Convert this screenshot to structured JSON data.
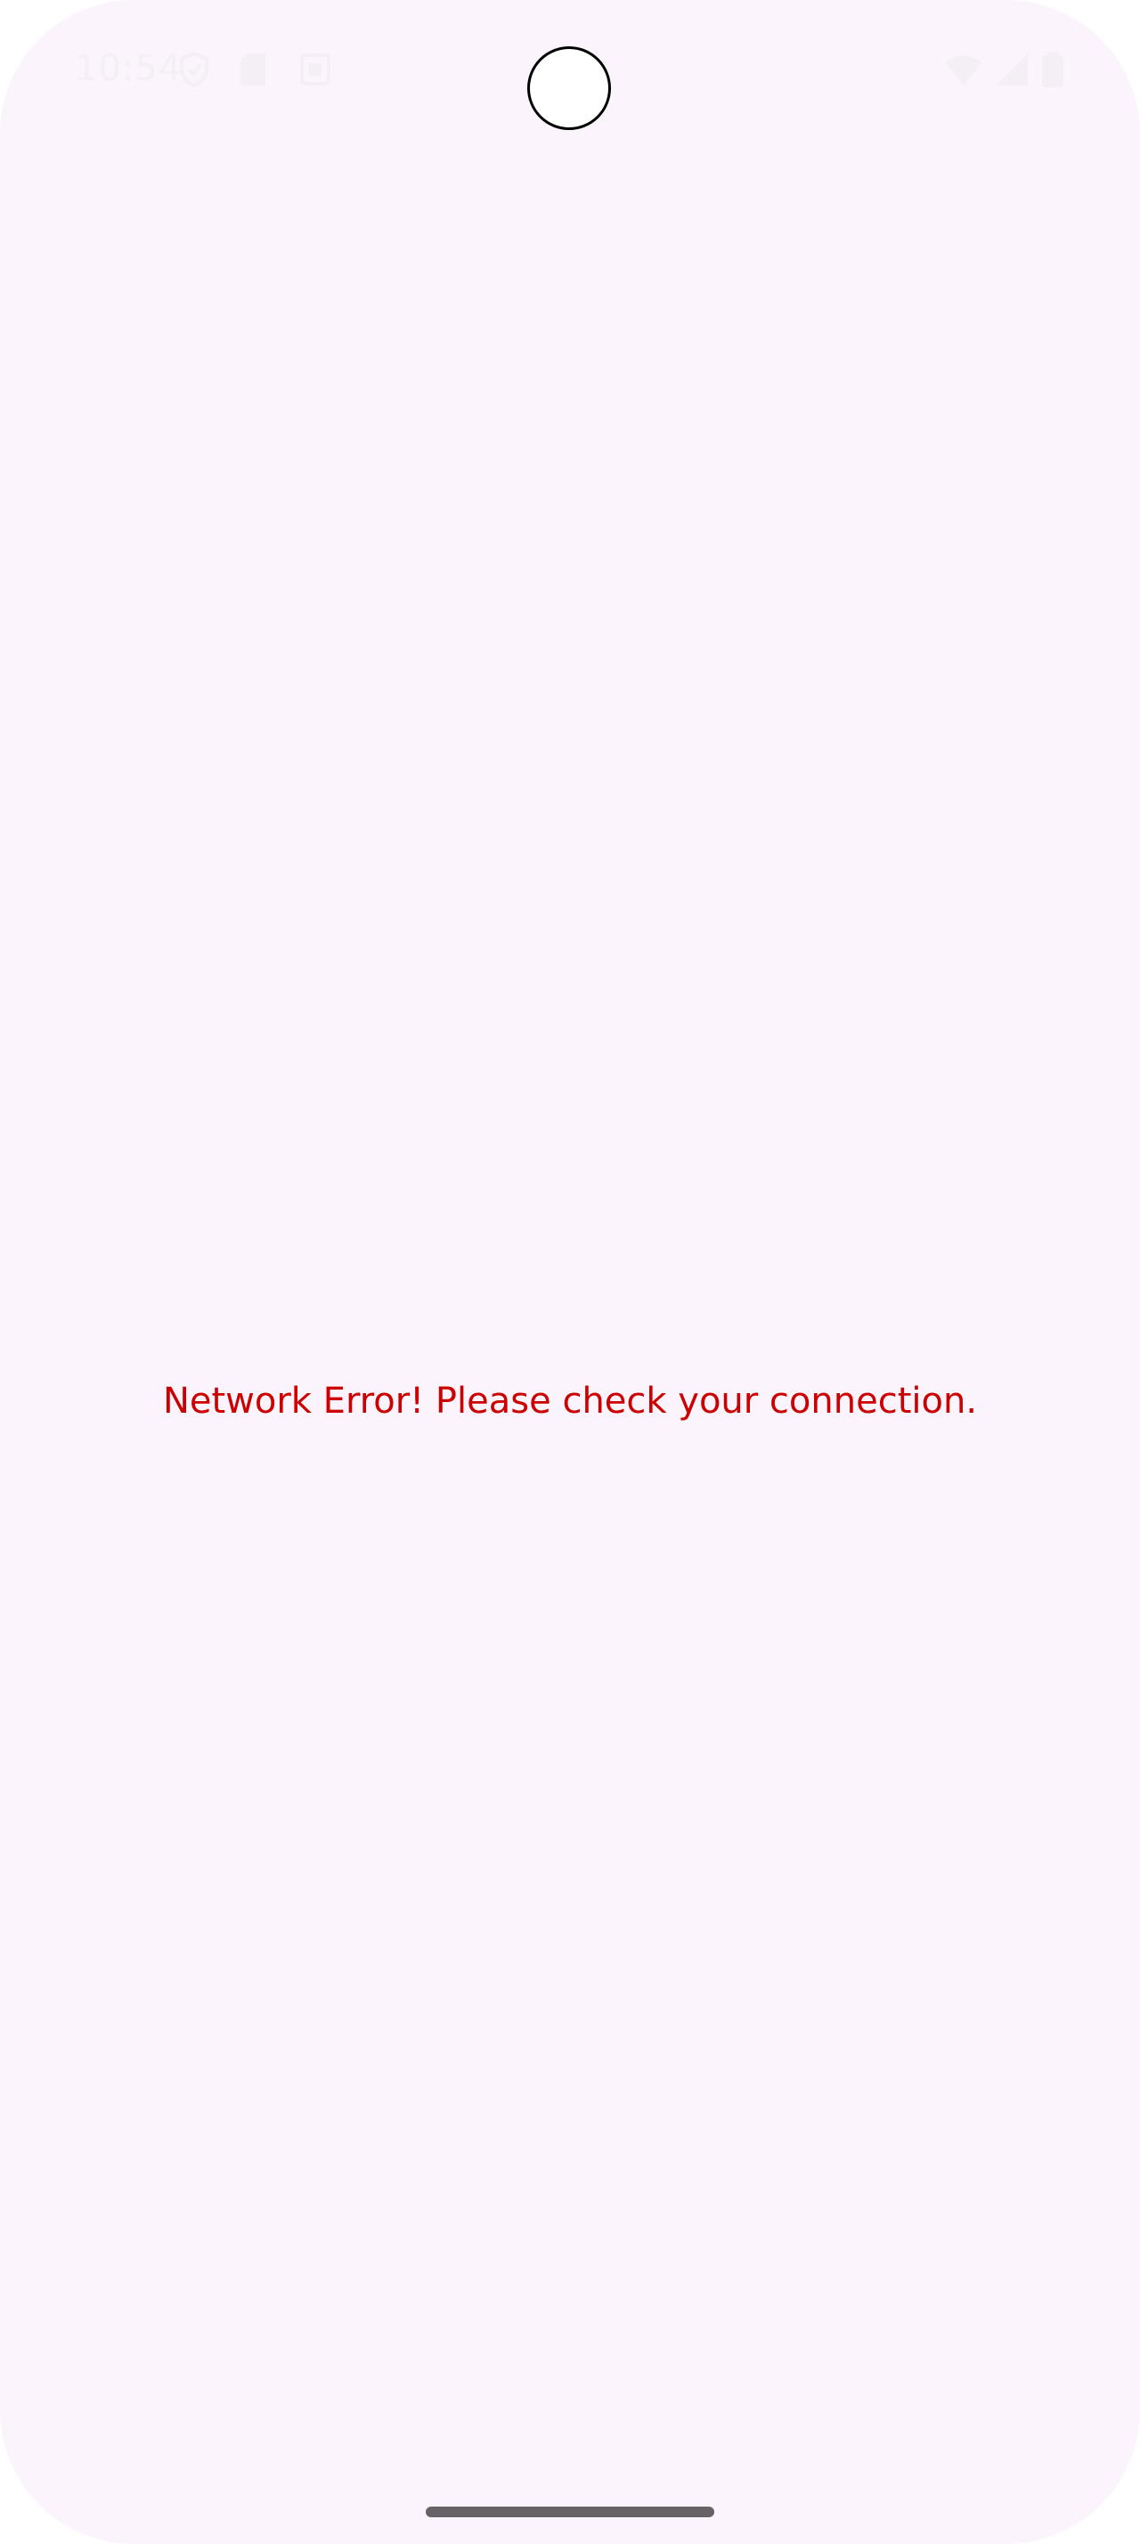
{
  "status_bar": {
    "time": "10:54",
    "icons_left": [
      "shield-icon",
      "sd-card-icon",
      "square-notification-icon"
    ],
    "icons_right": [
      "wifi-icon",
      "signal-icon",
      "battery-icon"
    ]
  },
  "main": {
    "error_message": "Network Error! Please check your connection.",
    "error_color": "#cc0000",
    "background_color": "#fbf4fc"
  }
}
